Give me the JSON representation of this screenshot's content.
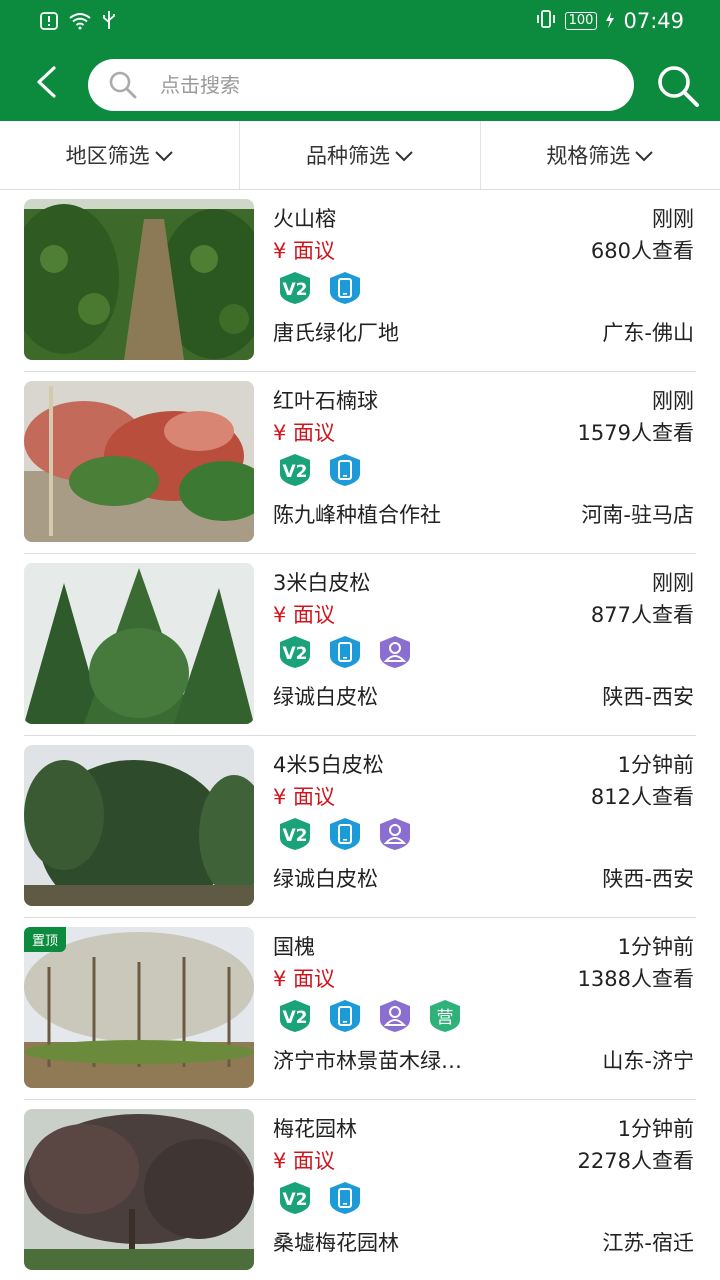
{
  "status_bar": {
    "time": "07:49",
    "battery": "100"
  },
  "search": {
    "placeholder": "点击搜索"
  },
  "filters": [
    "地区筛选",
    "品种筛选",
    "规格筛选"
  ],
  "items": [
    {
      "name": "火山榕",
      "price": "¥ 面议",
      "time": "刚刚",
      "views": "680人查看",
      "company": "唐氏绿化厂地",
      "region": "广东-佛山",
      "badges": [
        "v2",
        "phone"
      ],
      "pinned": false
    },
    {
      "name": "红叶石楠球",
      "price": "¥ 面议",
      "time": "刚刚",
      "views": "1579人查看",
      "company": "陈九峰种植合作社",
      "region": "河南-驻马店",
      "badges": [
        "v2",
        "phone"
      ],
      "pinned": false
    },
    {
      "name": "3米白皮松",
      "price": "¥ 面议",
      "time": "刚刚",
      "views": "877人查看",
      "company": "绿诚白皮松",
      "region": "陕西-西安",
      "badges": [
        "v2",
        "phone",
        "person"
      ],
      "pinned": false
    },
    {
      "name": "4米5白皮松",
      "price": "¥ 面议",
      "time": "1分钟前",
      "views": "812人查看",
      "company": "绿诚白皮松",
      "region": "陕西-西安",
      "badges": [
        "v2",
        "phone",
        "person"
      ],
      "pinned": false
    },
    {
      "name": "国槐",
      "price": "¥ 面议",
      "time": "1分钟前",
      "views": "1388人查看",
      "company": "济宁市林景苗木绿…",
      "region": "山东-济宁",
      "badges": [
        "v2",
        "phone",
        "person",
        "ying"
      ],
      "pinned": true,
      "pin_label": "置顶",
      "ying_label": "营"
    },
    {
      "name": "梅花园林",
      "price": "¥ 面议",
      "time": "1分钟前",
      "views": "2278人查看",
      "company": "桑墟梅花园林",
      "region": "江苏-宿迁",
      "badges": [
        "v2",
        "phone"
      ],
      "pinned": false
    }
  ],
  "colors": {
    "brand": "#0c8a3d",
    "price": "#d0141c",
    "badge_v2": "#1aa37a",
    "badge_phone": "#1d9bd8",
    "badge_person": "#8a6fd1",
    "badge_ying": "#2fb27a"
  }
}
